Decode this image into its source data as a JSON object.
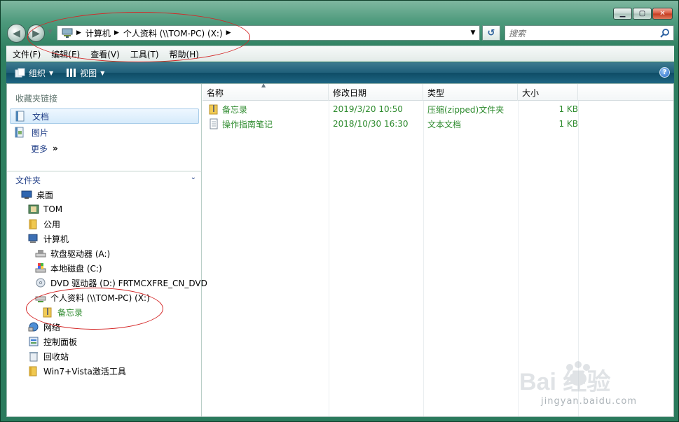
{
  "window": {
    "caption_buttons": [
      "minimize",
      "maximize",
      "close"
    ]
  },
  "address_bar": {
    "breadcrumbs": [
      "计算机",
      "个人资料 (\\\\TOM-PC) (X:)"
    ],
    "search_placeholder": "搜索"
  },
  "menubar": {
    "items": [
      "文件(F)",
      "编辑(E)",
      "查看(V)",
      "工具(T)",
      "帮助(H)"
    ]
  },
  "commandbar": {
    "organize_label": "组织",
    "views_label": "视图"
  },
  "nav_pane": {
    "favorites_header": "收藏夹链接",
    "favorites": [
      "文档",
      "图片"
    ],
    "more_label": "更多",
    "folders_header": "文件夹",
    "tree": [
      {
        "label": "桌面",
        "icon": "desktop-icon"
      },
      {
        "label": "TOM",
        "icon": "user-folder-icon"
      },
      {
        "label": "公用",
        "icon": "folder-icon"
      },
      {
        "label": "计算机",
        "icon": "computer-icon"
      },
      {
        "label": "软盘驱动器 (A:)",
        "icon": "floppy-drive-icon"
      },
      {
        "label": "本地磁盘 (C:)",
        "icon": "local-disk-icon"
      },
      {
        "label": "DVD 驱动器 (D:) FRTMCXFRE_CN_DVD",
        "icon": "dvd-drive-icon"
      },
      {
        "label": "个人资料 (\\\\TOM-PC) (X:)",
        "icon": "network-drive-icon"
      },
      {
        "label": "备忘录",
        "icon": "zip-folder-icon"
      },
      {
        "label": "网络",
        "icon": "network-icon"
      },
      {
        "label": "控制面板",
        "icon": "control-panel-icon"
      },
      {
        "label": "回收站",
        "icon": "recycle-bin-icon"
      },
      {
        "label": "Win7+Vista激活工具",
        "icon": "folder-icon"
      }
    ]
  },
  "content": {
    "columns": [
      "名称",
      "修改日期",
      "类型",
      "大小"
    ],
    "files": [
      {
        "name": "备忘录",
        "modified": "2019/3/20 10:50",
        "type": "压缩(zipped)文件夹",
        "size": "1 KB",
        "icon": "zip-folder-icon"
      },
      {
        "name": "操作指南笔记",
        "modified": "2018/10/30 16:30",
        "type": "文本文档",
        "size": "1 KB",
        "icon": "text-file-icon"
      }
    ]
  },
  "watermark": {
    "brand": "Bai 经验",
    "url": "jingyan.baidu.com"
  },
  "colors": {
    "window_frame": "#2e7f60",
    "command_bar": "#1f5f7a",
    "link_blue": "#1d3b85",
    "green_text": "#2e8b2e",
    "annotation_red": "#d42626"
  }
}
